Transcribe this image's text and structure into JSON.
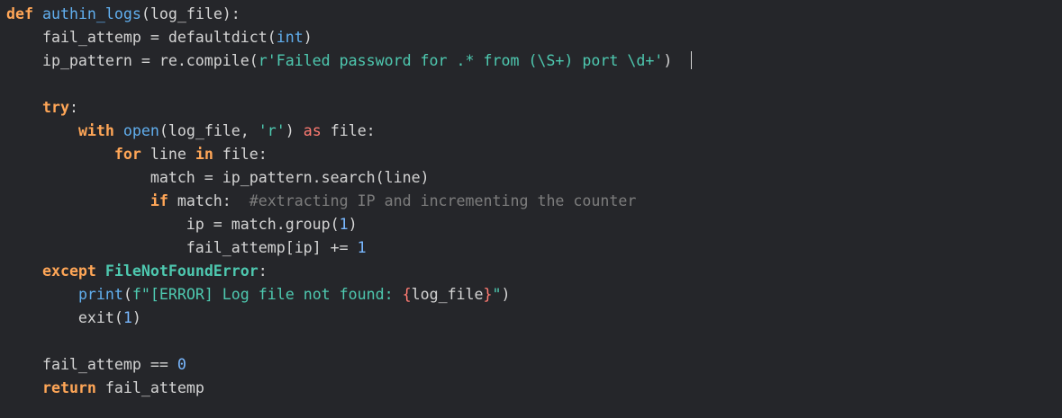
{
  "editor": {
    "theme": {
      "background": "#25262a",
      "plain": "#d4d4d4",
      "keyword": "#ffa657",
      "function": "#61afef",
      "builtin": "#61afef",
      "string": "#4ec9b0",
      "number": "#79b8ff",
      "comment": "#7d7d7d",
      "class": "#4ec9b0",
      "brace": "#ff7b72"
    },
    "lines": [
      [
        {
          "t": "def",
          "c": "keyword"
        },
        {
          "t": " ",
          "c": "plain"
        },
        {
          "t": "authin_logs",
          "c": "function"
        },
        {
          "t": "(log_file):",
          "c": "plain"
        }
      ],
      [
        {
          "t": "    fail_attemp = defaultdict(",
          "c": "plain"
        },
        {
          "t": "int",
          "c": "builtin"
        },
        {
          "t": ")",
          "c": "plain"
        }
      ],
      [
        {
          "t": "    ip_pattern = re.compile(",
          "c": "plain"
        },
        {
          "t": "r'Failed password for .* from (\\S+) port \\d+'",
          "c": "string"
        },
        {
          "t": ")",
          "c": "plain"
        }
      ],
      [],
      [
        {
          "t": "    ",
          "c": "plain"
        },
        {
          "t": "try",
          "c": "keyword"
        },
        {
          "t": ":",
          "c": "plain"
        }
      ],
      [
        {
          "t": "        ",
          "c": "plain"
        },
        {
          "t": "with",
          "c": "keyword"
        },
        {
          "t": " ",
          "c": "plain"
        },
        {
          "t": "open",
          "c": "builtin"
        },
        {
          "t": "(log_file, ",
          "c": "plain"
        },
        {
          "t": "'r'",
          "c": "string"
        },
        {
          "t": ") ",
          "c": "plain"
        },
        {
          "t": "as",
          "c": "brace"
        },
        {
          "t": " file:",
          "c": "plain"
        }
      ],
      [
        {
          "t": "            ",
          "c": "plain"
        },
        {
          "t": "for",
          "c": "keyword"
        },
        {
          "t": " line ",
          "c": "plain"
        },
        {
          "t": "in",
          "c": "keyword"
        },
        {
          "t": " file:",
          "c": "plain"
        }
      ],
      [
        {
          "t": "                match = ip_pattern.search(line)",
          "c": "plain"
        }
      ],
      [
        {
          "t": "                ",
          "c": "plain"
        },
        {
          "t": "if",
          "c": "keyword"
        },
        {
          "t": " match:  ",
          "c": "plain"
        },
        {
          "t": "#extracting IP and incrementing the counter",
          "c": "comment"
        }
      ],
      [
        {
          "t": "                    ip = match.group(",
          "c": "plain"
        },
        {
          "t": "1",
          "c": "number"
        },
        {
          "t": ")",
          "c": "plain"
        }
      ],
      [
        {
          "t": "                    fail_attemp[ip] += ",
          "c": "plain"
        },
        {
          "t": "1",
          "c": "number"
        }
      ],
      [
        {
          "t": "    ",
          "c": "plain"
        },
        {
          "t": "except",
          "c": "keyword"
        },
        {
          "t": " ",
          "c": "plain"
        },
        {
          "t": "FileNotFoundError",
          "c": "class"
        },
        {
          "t": ":",
          "c": "plain"
        }
      ],
      [
        {
          "t": "        ",
          "c": "plain"
        },
        {
          "t": "print",
          "c": "builtin"
        },
        {
          "t": "(",
          "c": "plain"
        },
        {
          "t": "f\"[ERROR] Log file not found: ",
          "c": "string"
        },
        {
          "t": "{",
          "c": "brace"
        },
        {
          "t": "log_file",
          "c": "plain"
        },
        {
          "t": "}",
          "c": "brace"
        },
        {
          "t": "\"",
          "c": "string"
        },
        {
          "t": ")",
          "c": "plain"
        }
      ],
      [
        {
          "t": "        exit(",
          "c": "plain"
        },
        {
          "t": "1",
          "c": "number"
        },
        {
          "t": ")",
          "c": "plain"
        }
      ],
      [],
      [
        {
          "t": "    fail_attemp == ",
          "c": "plain"
        },
        {
          "t": "0",
          "c": "number"
        }
      ],
      [
        {
          "t": "    ",
          "c": "plain"
        },
        {
          "t": "return",
          "c": "keyword"
        },
        {
          "t": " fail_attemp",
          "c": "plain"
        }
      ]
    ]
  }
}
